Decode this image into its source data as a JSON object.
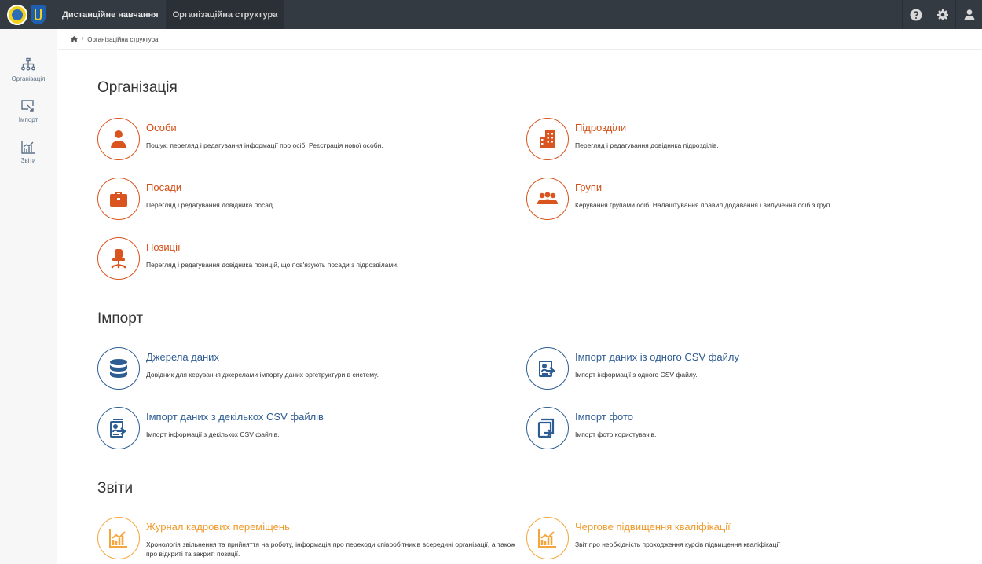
{
  "topbar": {
    "nav": [
      "Дистанційне навчання",
      "Організаційна структура"
    ],
    "active_index": 1,
    "right_icons": [
      "help-icon",
      "gear-icon",
      "user-icon"
    ]
  },
  "sidebar": {
    "items": [
      {
        "label": "Організація",
        "icon": "org-chart-icon"
      },
      {
        "label": "Імпорт",
        "icon": "import-icon"
      },
      {
        "label": "Звіти",
        "icon": "report-chart-icon"
      }
    ]
  },
  "breadcrumb": {
    "home_icon": "home-icon",
    "current": "Організаційна структура"
  },
  "colors": {
    "topbar": "#343a42",
    "orange": "#d24f16",
    "blue": "#2e5c92",
    "gold": "#f09a2b"
  },
  "sections": {
    "organization": {
      "title": "Організація",
      "cards": [
        {
          "title": "Особи",
          "desc": "Пошук, перегляд і редагування інформації про осіб. Реєстрація нової особи.",
          "icon": "person-icon"
        },
        {
          "title": "Підрозділи",
          "desc": "Перегляд і редагування довідника підрозділів.",
          "icon": "building-icon"
        },
        {
          "title": "Посади",
          "desc": "Перегляд і редагування довідника посад.",
          "icon": "briefcase-icon"
        },
        {
          "title": "Групи",
          "desc": "Керування групами осіб. Налаштування правил додавання і вилучення осіб з груп.",
          "icon": "group-icon"
        },
        {
          "title": "Позиції",
          "desc": "Перегляд і редагування довідника позицій, що пов'язують посади з підрозділами.",
          "icon": "office-chair-icon"
        }
      ]
    },
    "import": {
      "title": "Імпорт",
      "cards": [
        {
          "title": "Джерела даних",
          "desc": "Довідник для керування джерелами імпорту даних оргструктури в систему.",
          "icon": "database-icon"
        },
        {
          "title": "Імпорт даних із одного CSV файлу",
          "desc": "Імпорт інформації з одного CSV файлу.",
          "icon": "file-import-icon"
        },
        {
          "title": "Імпорт даних з декількох CSV файлів",
          "desc": "Імпорт інформації з декількох CSV файлів.",
          "icon": "files-import-icon"
        },
        {
          "title": "Імпорт фото",
          "desc": "Імпорт фото користувачів.",
          "icon": "photo-import-icon"
        }
      ]
    },
    "reports": {
      "title": "Звіти",
      "cards": [
        {
          "title": "Журнал кадрових переміщень",
          "desc": "Хронологія звільнення та прийняття на роботу, інформація про переходи співробітників всередині організації, а також про відкриті та закриті позиції.",
          "icon": "report-chart-icon"
        },
        {
          "title": "Чергове підвищення кваліфікації",
          "desc": "Звіт про необхідність проходження курсів підвищення кваліфікації",
          "icon": "report-chart-icon"
        }
      ]
    }
  }
}
